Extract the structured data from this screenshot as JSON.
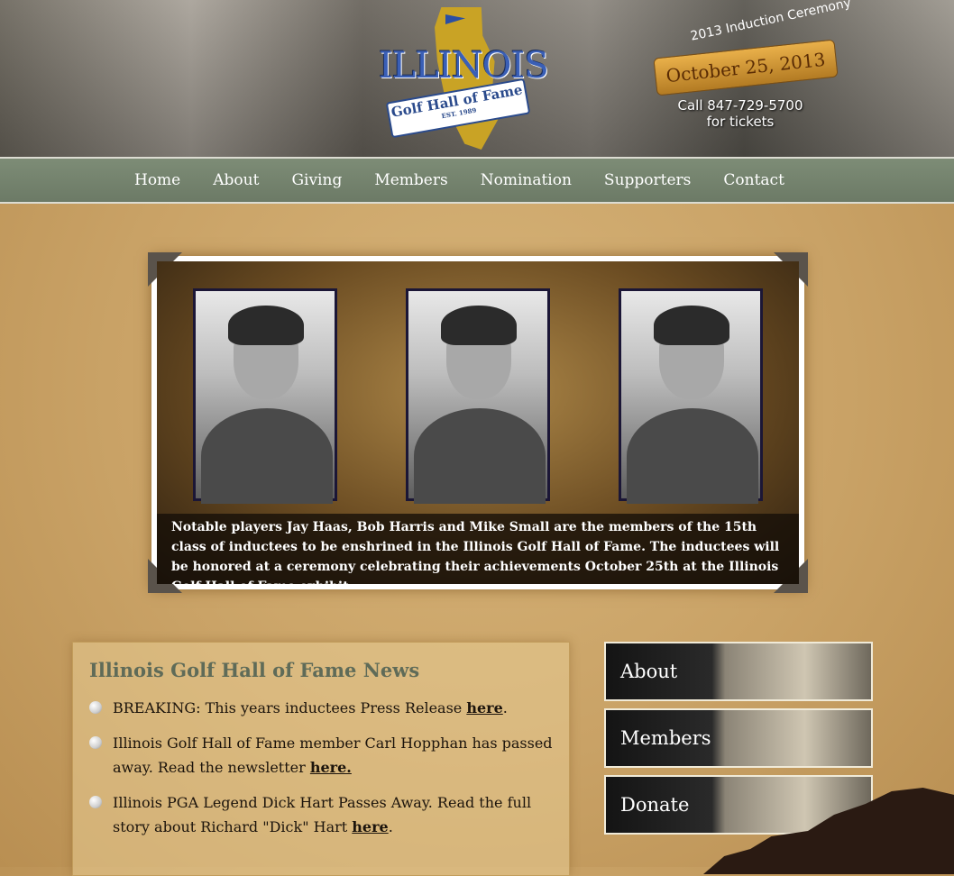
{
  "header": {
    "logo_title": "ILLINOIS",
    "logo_subtitle": "Golf Hall of Fame",
    "logo_est": "EST. 1989",
    "event_curve": "2013 Induction Ceremony",
    "event_date": "October 25, 2013",
    "event_phone": "Call 847-729-5700",
    "event_tickets": "for tickets"
  },
  "nav": {
    "items": [
      {
        "label": "Home"
      },
      {
        "label": "About"
      },
      {
        "label": "Giving"
      },
      {
        "label": "Members"
      },
      {
        "label": "Nomination"
      },
      {
        "label": "Supporters"
      },
      {
        "label": "Contact"
      }
    ]
  },
  "slideshow": {
    "caption": "Notable players Jay Haas, Bob Harris and Mike Small are the members of the 15th class of inductees to be enshrined in the Illinois Golf Hall of Fame. The inductees will be honored at a ceremony celebrating their achievements October 25th at the Illinois Golf Hall of Fame exhibit."
  },
  "news": {
    "title": "Illinois Golf Hall of Fame News",
    "items": [
      {
        "text": "BREAKING: This years inductees Press Release ",
        "link": "here",
        "after": "."
      },
      {
        "text": "Illinois Golf Hall of Fame member Carl Hopphan has passed away. Read the newsletter ",
        "link": "here.",
        "after": ""
      },
      {
        "text": "Illinois PGA Legend Dick Hart Passes Away. Read the full story about Richard \"Dick\" Hart ",
        "link": "here",
        "after": "."
      }
    ]
  },
  "side": {
    "about": "About",
    "members": "Members",
    "donate": "Donate"
  }
}
